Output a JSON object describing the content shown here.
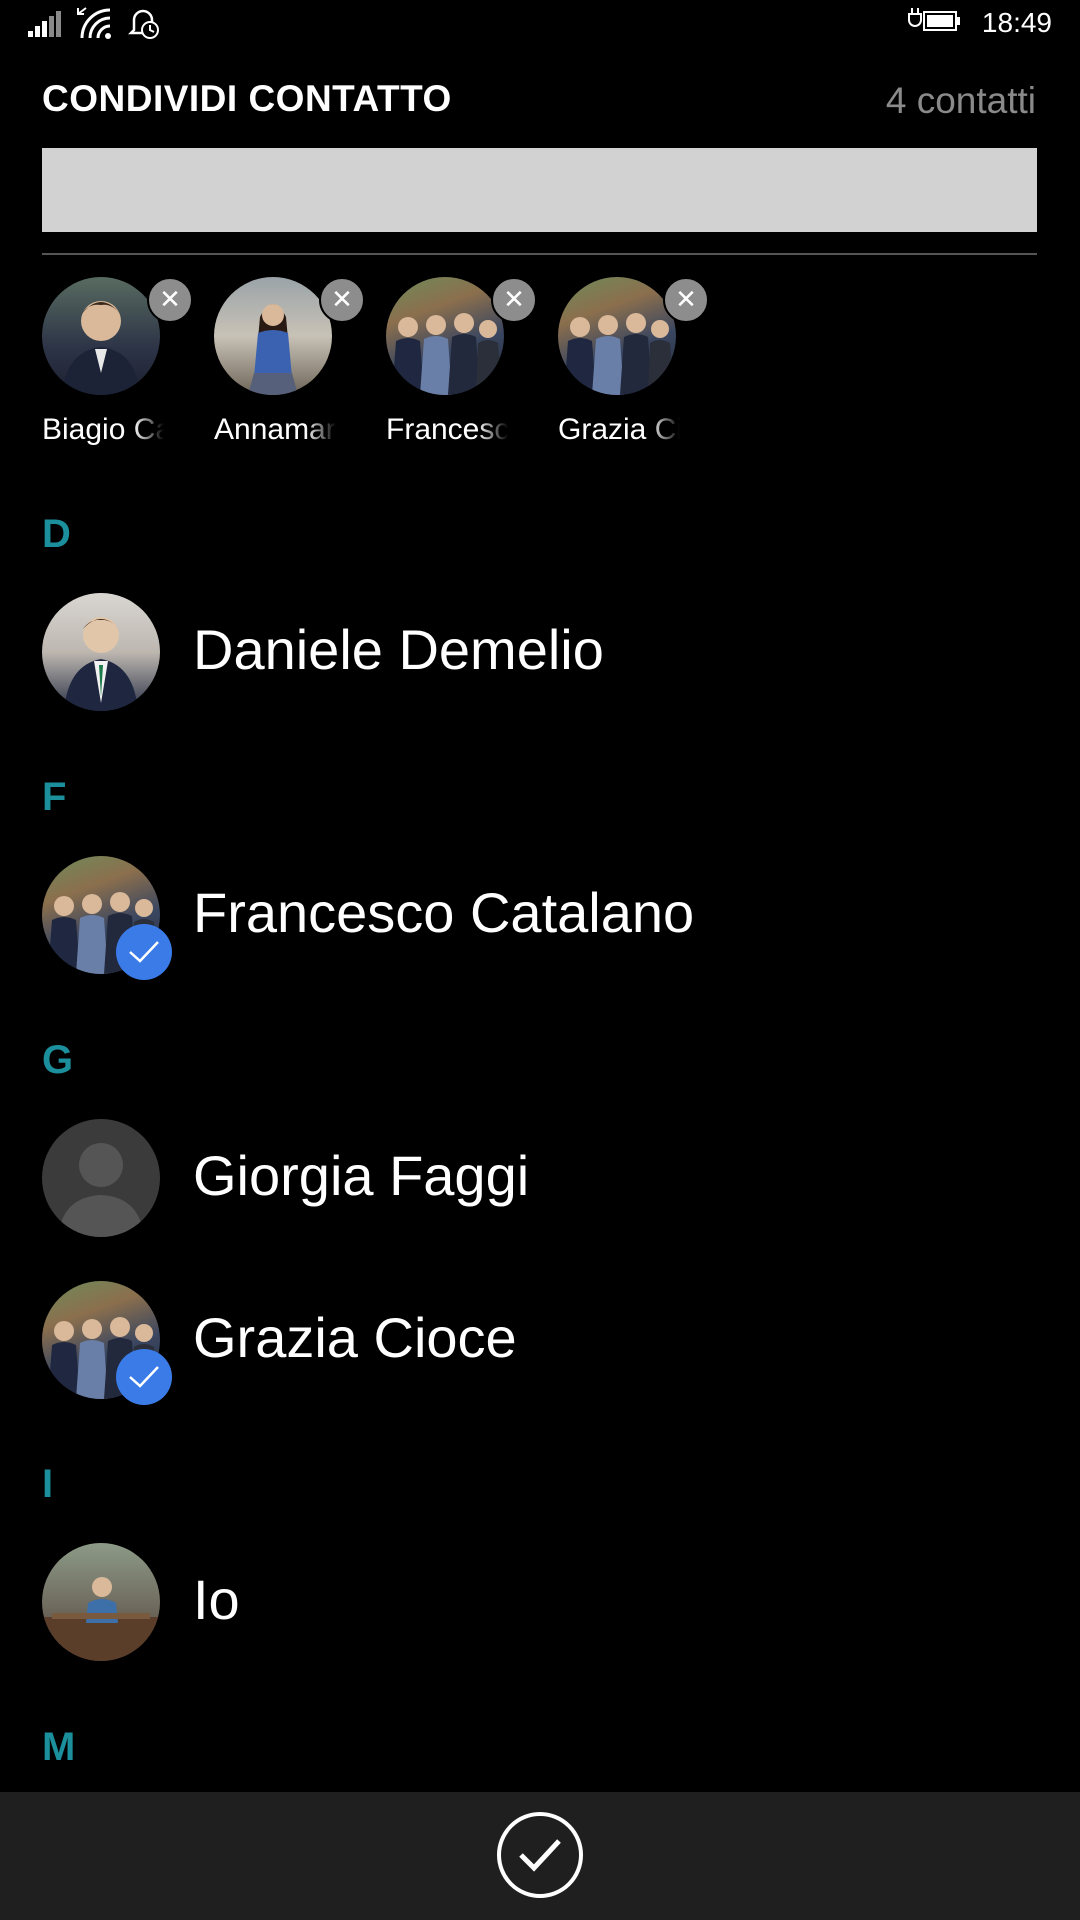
{
  "status": {
    "time": "18:49",
    "icons": [
      "signal-bars-icon",
      "wifi-icon",
      "quiet-hours-icon",
      "battery-charging-icon"
    ]
  },
  "header": {
    "title": "CONDIVIDI CONTATTO",
    "count": "4 contatti"
  },
  "search": {
    "value": "",
    "placeholder": ""
  },
  "selected": [
    {
      "name": "Biagio Ca",
      "photo": "man"
    },
    {
      "name": "Annamar",
      "photo": "girl"
    },
    {
      "name": "Francesc",
      "photo": "group"
    },
    {
      "name": "Grazia Ci",
      "photo": "group"
    }
  ],
  "sections": {
    "d": "D",
    "f": "F",
    "g": "G",
    "i": "I",
    "m": "M"
  },
  "contacts": {
    "daniele": {
      "name": "Daniele Demelio",
      "selected": false
    },
    "francesco": {
      "name": "Francesco Catalano",
      "selected": true
    },
    "giorgia": {
      "name": "Giorgia Faggi",
      "selected": false
    },
    "grazia": {
      "name": "Grazia Cioce",
      "selected": true
    },
    "io": {
      "name": "Io",
      "selected": false
    }
  },
  "colors": {
    "accent": "#1b8f9c",
    "check": "#3a7be8",
    "appbar": "#1f1f1f"
  }
}
